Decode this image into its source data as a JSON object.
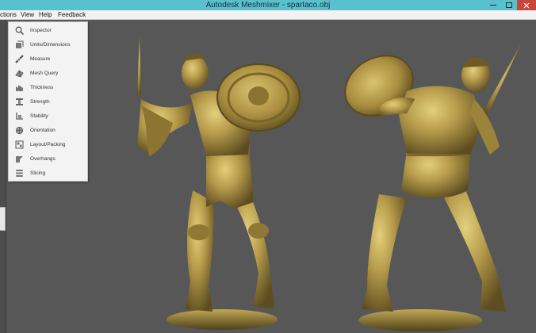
{
  "window": {
    "title": "Autodesk Meshmixer - spartaco.obj"
  },
  "menu": {
    "items": [
      "ctions",
      "View",
      "Help",
      "Feedback"
    ]
  },
  "analysis_menu": {
    "items": [
      {
        "label": "Inspector",
        "icon": "inspector-icon"
      },
      {
        "label": "Units/Dimensions",
        "icon": "units-dimensions-icon"
      },
      {
        "label": "Measure",
        "icon": "measure-icon"
      },
      {
        "label": "Mesh Query",
        "icon": "mesh-query-icon"
      },
      {
        "label": "Thickness",
        "icon": "thickness-icon"
      },
      {
        "label": "Strength",
        "icon": "strength-icon"
      },
      {
        "label": "Stability",
        "icon": "stability-icon"
      },
      {
        "label": "Orientation",
        "icon": "orientation-icon"
      },
      {
        "label": "Layout/Packing",
        "icon": "layout-packing-icon"
      },
      {
        "label": "Overhangs",
        "icon": "overhangs-icon"
      },
      {
        "label": "Slicing",
        "icon": "slicing-icon"
      }
    ]
  },
  "colors": {
    "titlebar": "#59c0cd",
    "viewport_background": "#575757",
    "model_gold": "#b59a4a",
    "model_highlight": "#e3cf7c",
    "model_shadow": "#5e4d20"
  }
}
